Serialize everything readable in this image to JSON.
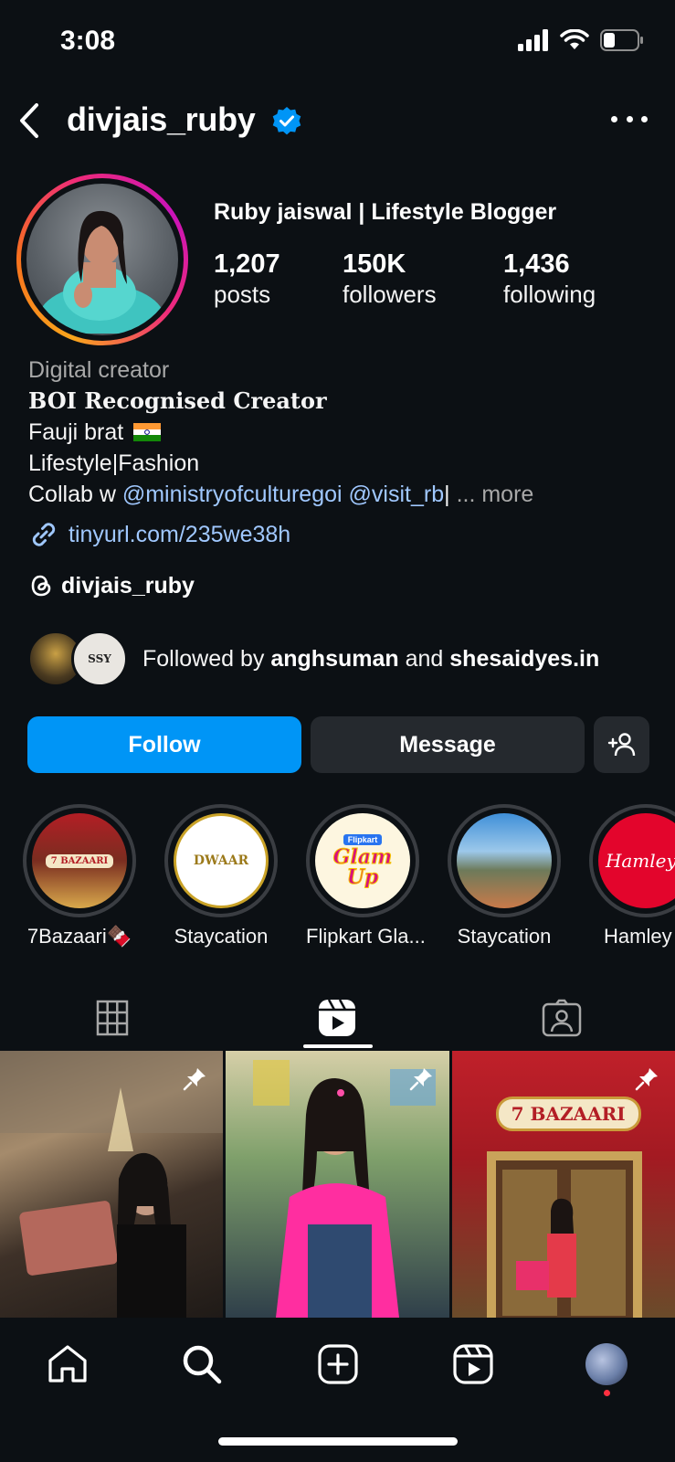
{
  "status": {
    "time": "3:08"
  },
  "header": {
    "username": "divjais_ruby"
  },
  "profile": {
    "full_name": "Ruby jaiswal | Lifestyle Blogger",
    "stats": [
      {
        "value": "1,207",
        "label": "posts"
      },
      {
        "value": "150K",
        "label": "followers"
      },
      {
        "value": "1,436",
        "label": "following"
      }
    ],
    "bio": {
      "category": "Digital creator",
      "line1": "BOI Recognised Creator",
      "line2": "Fauji brat",
      "line3": "Lifestyle|Fashion",
      "line4_prefix": "Collab w ",
      "mention1": "@ministryofculturegoi",
      "mention2": "@visit_rb",
      "line4_suffix": "|",
      "more": "... more"
    },
    "link": "tinyurl.com/235we38h",
    "threads_handle": "divjais_ruby",
    "followed_by": {
      "prefix": "Followed by ",
      "user1": "anghsuman",
      "joiner": " and ",
      "user2": "shesaidyes.in",
      "mini2_text": "SSY"
    }
  },
  "actions": {
    "follow": "Follow",
    "message": "Message"
  },
  "highlights": [
    {
      "label": "7Bazaari🍫",
      "art": "7 BAZAARI"
    },
    {
      "label": "Staycation",
      "art": "DWAAR"
    },
    {
      "label": "Flipkart Gla...",
      "art": "Glam Up",
      "art_top": "Flipkart"
    },
    {
      "label": "Staycation",
      "art": ""
    },
    {
      "label": "Hamley",
      "art": "Hamleys"
    }
  ],
  "grid": {
    "cell3_sign": "7 BAZAARI"
  },
  "colors": {
    "background": "#0c1014",
    "follow_button": "#0095f6",
    "secondary_button": "#25292e",
    "link": "#a0c8ff",
    "notification_dot": "#ff3040"
  }
}
